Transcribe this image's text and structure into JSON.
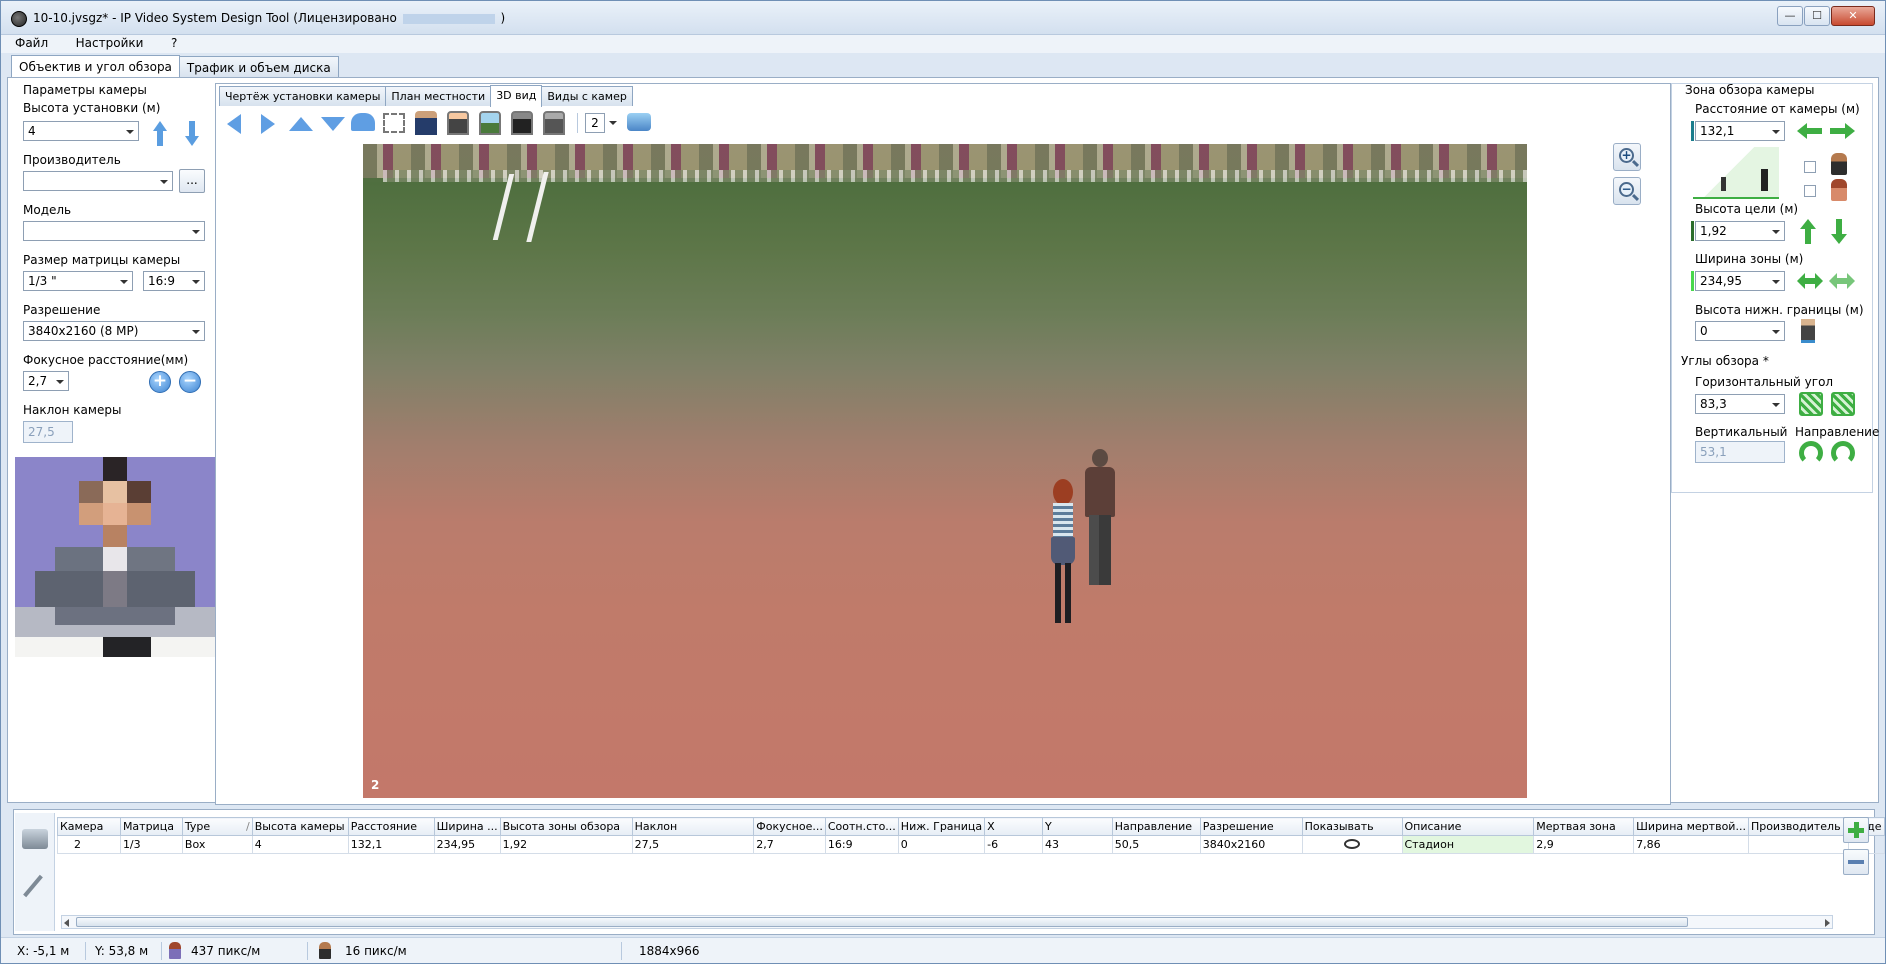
{
  "window": {
    "title": "10-10.jvsgz* - IP Video System Design Tool (Лицензировано",
    "title_suffix": ")",
    "minimize": "—",
    "maximize": "☐",
    "close": "✕"
  },
  "menu": [
    "Файл",
    "Настройки",
    "?"
  ],
  "main_tabs": [
    "Объектив и угол обзора",
    "Трафик и объем диска"
  ],
  "left": {
    "group_title": "Параметры камеры",
    "height_label": "Высота установки (м)",
    "height_value": "4",
    "manufacturer_label": "Производитель",
    "manufacturer_value": "",
    "browse_button": "...",
    "model_label": "Модель",
    "model_value": "",
    "sensor_label": "Размер матрицы камеры",
    "sensor_value": "1/3 \"",
    "aspect_value": "16:9",
    "resolution_label": "Разрешение",
    "resolution_value": "3840x2160 (8 MP)",
    "focal_label": "Фокусное расстояние(мм)",
    "focal_value": "2,7",
    "tilt_label": "Наклон камеры",
    "tilt_value": "27,5"
  },
  "sub_tabs": [
    "Чертёж установки камеры",
    "План местности",
    "3D вид",
    "Виды с камер"
  ],
  "toolbar": {
    "camera_number": "2"
  },
  "viewport": {
    "camera_label": "2"
  },
  "right": {
    "zone_title": "Зона обзора камеры",
    "distance_label": "Расстояние от камеры (м)",
    "distance_value": "132,1",
    "target_height_label": "Высота цели (м)",
    "target_height_value": "1,92",
    "zone_width_label": "Ширина зоны (м)",
    "zone_width_value": "234,95",
    "lower_bound_label": "Высота нижн. границы (м)",
    "lower_bound_value": "0",
    "angles_title": "Углы обзора *",
    "horizontal_label": "Горизонтальный угол",
    "horizontal_value": "83,3",
    "vertical_label": "Вертикальный",
    "vertical_value": "53,1",
    "direction_label": "Направление"
  },
  "grid": {
    "columns": [
      "Камера",
      "Матрица",
      "Type",
      "Высота камеры",
      "Расстояние",
      "Ширина ...",
      "Высота зоны обзора",
      "Наклон",
      "Фокусное...",
      "Соотн.сто...",
      "Ниж. Граница",
      "X",
      "Y",
      "Направление",
      "Разрешение",
      "Показывать",
      "Описание",
      "Мертвая зона",
      "Ширина мертвой...",
      "Производитель",
      "Моде"
    ],
    "sort_marker": "/",
    "rows": [
      [
        "2",
        "1/3",
        "Box",
        "4",
        "132,1",
        "234,95",
        "1,92",
        "27,5",
        "2,7",
        "16:9",
        "0",
        "-6",
        "43",
        "50,5",
        "3840x2160",
        "",
        "Стадион",
        "2,9",
        "7,86",
        "",
        ""
      ]
    ]
  },
  "status": {
    "x": "X: -5,1 м",
    "y": "Y: 53,8 м",
    "px_face": "437 пикс/м",
    "px_body": "16 пикс/м",
    "size": "1884x966"
  },
  "colors": {
    "accent_blue": "#5a9de0",
    "accent_green": "#3eae43",
    "description_bg": "#e2f7df"
  }
}
